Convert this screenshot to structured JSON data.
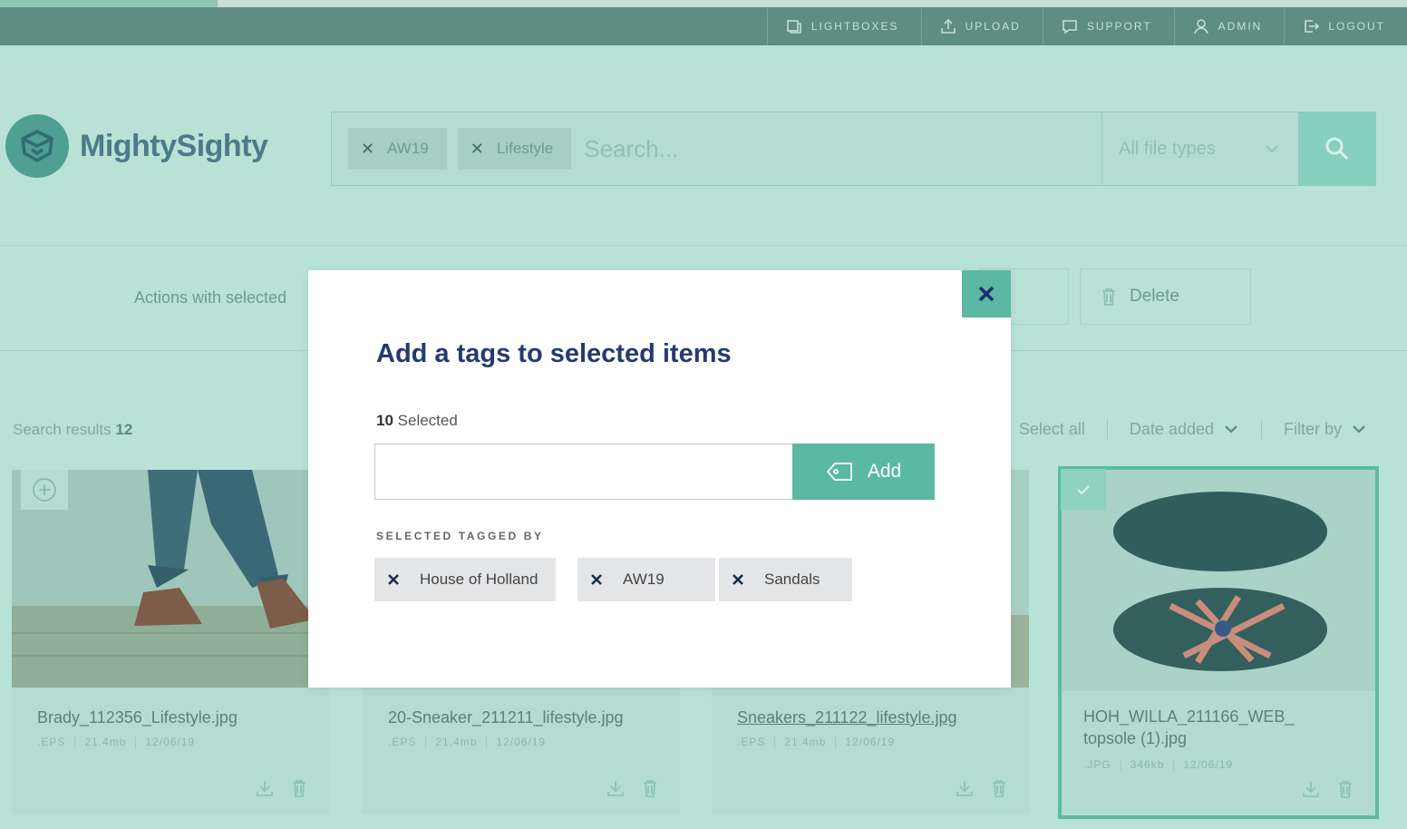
{
  "nav": {
    "items": [
      {
        "label": "LIGHTBOXES",
        "icon": "lightbox-icon"
      },
      {
        "label": "UPLOAD",
        "icon": "upload-icon"
      },
      {
        "label": "SUPPORT",
        "icon": "support-icon"
      },
      {
        "label": "ADMIN",
        "icon": "user-icon"
      },
      {
        "label": "LOGOUT",
        "icon": "logout-icon"
      }
    ]
  },
  "brand": {
    "name": "MightySighty",
    "color": "#4f9f92"
  },
  "search": {
    "chips": [
      "AW19",
      "Lifestyle"
    ],
    "placeholder": "Search...",
    "file_type": "All file types"
  },
  "actions": {
    "label": "Actions with selected",
    "delete_label": "Delete"
  },
  "results": {
    "label": "Search results",
    "count": "12",
    "select_all": "Select all",
    "sort": "Date added",
    "filter": "Filter by"
  },
  "cards": [
    {
      "filename": "Brady_112356_Lifestyle.jpg",
      "type": ".EPS",
      "size": "21.4mb",
      "date": "12/06/19"
    },
    {
      "filename": "20-Sneaker_211211_lifestyle.jpg",
      "type": ".EPS",
      "size": "21.4mb",
      "date": "12/06/19"
    },
    {
      "filename": "Sneakers_211122_lifestyle.jpg",
      "type": ".EPS",
      "size": "21.4mb",
      "date": "12/06/19"
    },
    {
      "filename_line1": "HOH_WILLA_211166_WEB_",
      "filename_line2": "topsole (1).jpg",
      "type": ".JPG",
      "size": "346kb",
      "date": "12/06/19"
    }
  ],
  "modal": {
    "title": "Add a tags to selected items",
    "selected_count": "10",
    "selected_suffix": "Selected",
    "add_label": "Add",
    "tagged_label": "SELECTED TAGGED BY",
    "tags": [
      "House of Holland",
      "AW19",
      "Sandals"
    ],
    "accent_color": "#5bb8a3",
    "title_color": "#243a70"
  }
}
